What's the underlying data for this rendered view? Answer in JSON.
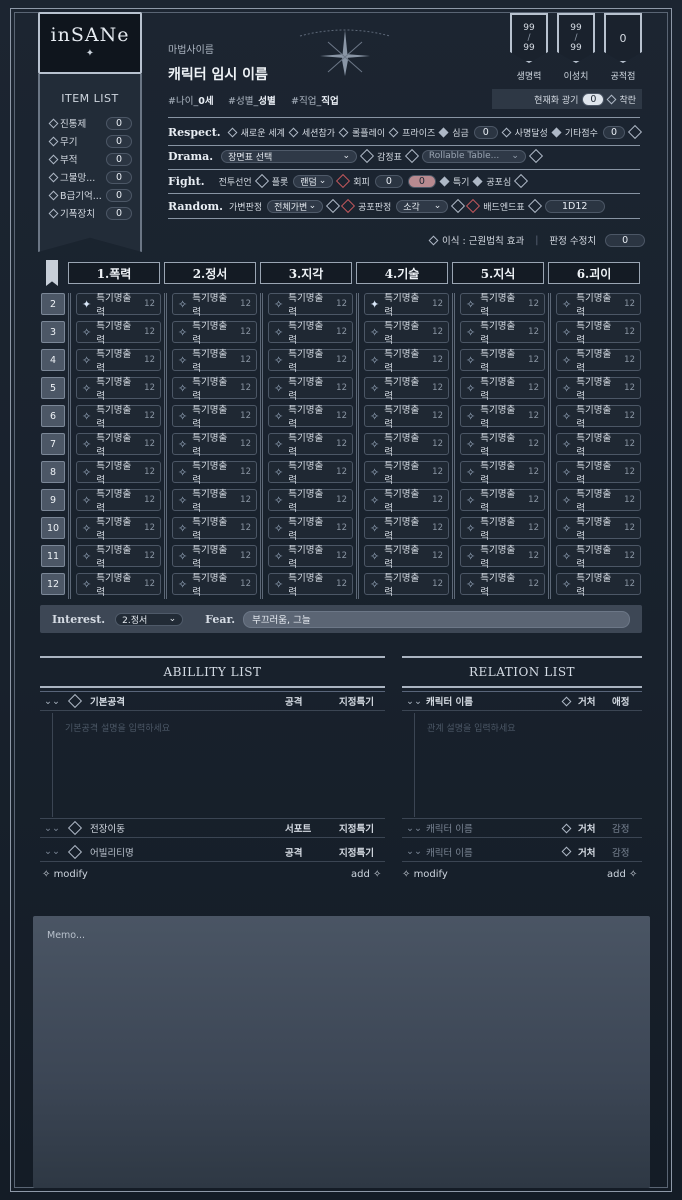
{
  "logo": {
    "text": "inSANe"
  },
  "item_list": {
    "title": "ITEM LIST",
    "items": [
      {
        "label": "진통제",
        "value": "0"
      },
      {
        "label": "무기",
        "value": "0"
      },
      {
        "label": "부적",
        "value": "0"
      },
      {
        "label": "그물망...",
        "value": "0"
      },
      {
        "label": "B급기억...",
        "value": "0"
      },
      {
        "label": "기폭장치",
        "value": "0"
      }
    ]
  },
  "character": {
    "sub": "마법사이름",
    "name": "캐릭터 임시 이름",
    "tags": [
      {
        "prefix": "#나이_",
        "value": "0세"
      },
      {
        "prefix": "#성별_",
        "value": "성별"
      },
      {
        "prefix": "#직업_",
        "value": "직업"
      }
    ]
  },
  "stats": [
    {
      "label": "생명력",
      "current": "99",
      "max": "99"
    },
    {
      "label": "이성치",
      "current": "99",
      "max": "99"
    },
    {
      "label": "공적점",
      "current": "0",
      "max": ""
    }
  ],
  "madness": {
    "label": "현재화 광기",
    "value": "0",
    "toggle": "착란"
  },
  "respect": {
    "title": "Respect.",
    "items": [
      "새로운 세계",
      "세션참가",
      "롤플레이",
      "프라이즈"
    ],
    "shimgeum": "심금",
    "shimgeum_value": "0",
    "goal": "사명달성",
    "other": "기타점수",
    "other_value": "0"
  },
  "drama": {
    "title": "Drama.",
    "scene_select": "장면표 선택",
    "emotion": "감정표",
    "rollable": "Rollable Table..."
  },
  "fight": {
    "title": "Fight.",
    "declare": "전투선언",
    "plot": "플롯",
    "plot_select": "랜덤",
    "evade": "회피",
    "evade_a": "0",
    "evade_b": "0",
    "special": "특기",
    "fear": "공포심"
  },
  "random": {
    "title": "Random.",
    "variable": "가변판정",
    "variable_select": "전체가변",
    "fear_check": "공포판정",
    "fear_select": "소각",
    "bad_end": "배드엔드표",
    "dice": "1D12"
  },
  "rule": {
    "label": "이식 : 근원법칙 효과",
    "mod_label": "판정 수정치",
    "mod_value": "0"
  },
  "skill_columns": [
    "1.폭력",
    "2.정서",
    "3.지각",
    "4.기술",
    "5.지식",
    "6.괴이"
  ],
  "skill_rows": [
    "2",
    "3",
    "4",
    "5",
    "6",
    "7",
    "8",
    "9",
    "10",
    "11",
    "12"
  ],
  "skill_cell": {
    "label": "특기명출력",
    "cost": "12"
  },
  "interest": {
    "label": "Interest.",
    "value": "2.정서",
    "fear_label": "Fear.",
    "fear_value": "부끄러움, 그늘"
  },
  "ability": {
    "title": "ABILLITY LIST",
    "header": {
      "name": "기본공격",
      "type": "공격",
      "spec": "지정특기"
    },
    "placeholder": "기본공격 설명을 입력하세요",
    "rows": [
      {
        "name": "전장이동",
        "type": "서포트",
        "spec": "지정특기"
      },
      {
        "name": "어빌리티명",
        "type": "공격",
        "spec": "지정특기"
      }
    ],
    "modify": "modify",
    "add": "add"
  },
  "relation": {
    "title": "RELATION LIST",
    "header": {
      "name": "캐릭터 이름",
      "place": "거처",
      "emotion": "애정"
    },
    "placeholder": "관계 설명을 입력하세요",
    "rows": [
      {
        "name": "캐릭터 이름",
        "place": "거처",
        "emotion": "감정"
      },
      {
        "name": "캐릭터 이름",
        "place": "거처",
        "emotion": "감정"
      }
    ],
    "modify": "modify",
    "add": "add"
  },
  "memo": {
    "placeholder": "Memo..."
  }
}
